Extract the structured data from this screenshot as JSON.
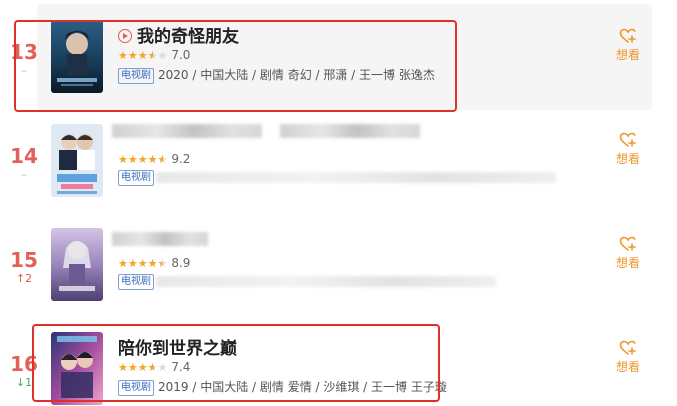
{
  "want_label": "想看",
  "tag_label": "电视剧",
  "rows": [
    {
      "rank": "13",
      "trend": "–",
      "title": "我的奇怪朋友",
      "score": "7.0",
      "rating_fraction": 0.7,
      "meta": "2020 / 中国大陆 / 剧情 奇幻 / 邢潇 / 王一博 张逸杰",
      "poster_colors": [
        "#1a3d5c",
        "#4f8fb8",
        "#0f1f33"
      ]
    },
    {
      "rank": "14",
      "trend": "–",
      "title": "",
      "score": "9.2",
      "rating_fraction": 0.92,
      "meta": "",
      "poster_colors": [
        "#d8e6f2",
        "#a3bcd6",
        "#6e8bb0"
      ]
    },
    {
      "rank": "15",
      "trend": "↑2",
      "title": "",
      "score": "8.9",
      "rating_fraction": 0.89,
      "meta": "",
      "poster_colors": [
        "#c9b9d9",
        "#8d79b0",
        "#4a3c6a"
      ]
    },
    {
      "rank": "16",
      "trend": "↓1",
      "title": "陪你到世界之巅",
      "score": "7.4",
      "rating_fraction": 0.74,
      "meta": "2019 / 中国大陆 / 剧情 爱情 / 沙维琪 / 王一博 王子璇",
      "poster_colors": [
        "#2a2f6e",
        "#b04ea0",
        "#e8a0c8"
      ]
    }
  ],
  "colors": {
    "rank": "#e0605a",
    "accent": "#f0972b",
    "highlight": "#e0302a",
    "tag": "#3a6dbf"
  }
}
